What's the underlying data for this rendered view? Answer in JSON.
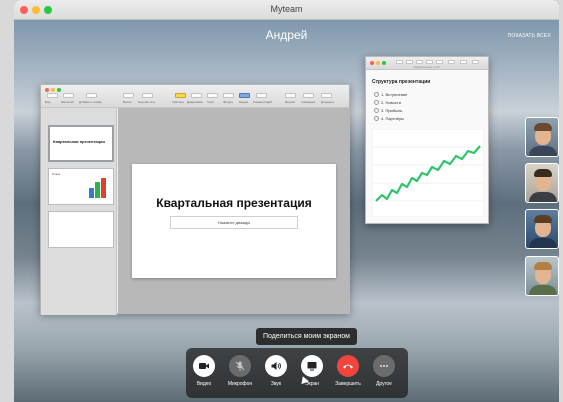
{
  "window": {
    "title": "Myteam"
  },
  "call": {
    "caller_name": "Андрей",
    "show_all_label": "ПОКАЗАТЬ ВСЕХ"
  },
  "keynote": {
    "toolbar_labels": [
      "Вид",
      "Масштаб",
      "Добавить слайд",
      "Воспр.",
      "Keynote Live",
      "Таблица",
      "Диаграмма",
      "Текст",
      "Фигура",
      "Медиа",
      "Комментарий",
      "Формат",
      "Анимация",
      "Документ"
    ],
    "thumbnails": [
      {
        "title": "Квартальная презентация"
      },
      {
        "title": "Показ"
      },
      {
        "title": ""
      }
    ],
    "slide": {
      "title": "Квартальная презентация",
      "subtitle": "Нажмите дважды"
    }
  },
  "outline": {
    "window_title": "Квартальный отчёт",
    "heading": "Структура презентации",
    "items": [
      "1. Вступление",
      "2. Новости",
      "3. Прибыль",
      "4. Партнёры"
    ]
  },
  "participants": [
    "participant-1",
    "participant-2",
    "participant-3",
    "participant-4"
  ],
  "share": {
    "tooltip": "Поделиться моим экраном"
  },
  "controls": [
    {
      "id": "video",
      "label": "Видео",
      "icon": "camera-icon"
    },
    {
      "id": "mic",
      "label": "Микрофон",
      "icon": "microphone-off-icon"
    },
    {
      "id": "sound",
      "label": "Звук",
      "icon": "speaker-icon"
    },
    {
      "id": "screen",
      "label": "Экран",
      "icon": "screen-share-icon"
    },
    {
      "id": "end",
      "label": "Завершить",
      "icon": "hang-up-icon"
    },
    {
      "id": "more",
      "label": "Другое",
      "icon": "more-icon"
    }
  ],
  "colors": {
    "hangup": "#f0453d",
    "chart_line": "#2fc46a",
    "close": "#ff5f57",
    "minimize": "#febc2e",
    "zoom": "#28c840"
  }
}
